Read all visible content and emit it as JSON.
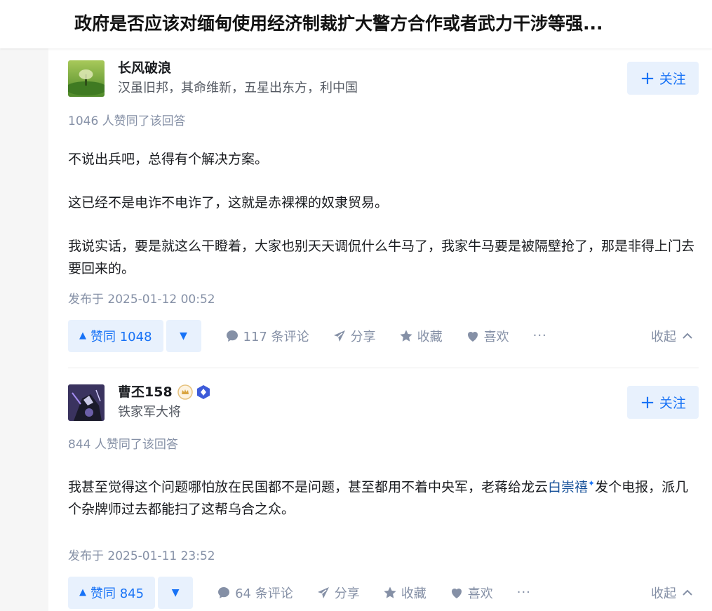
{
  "question": {
    "title": "政府是否应该对缅甸使用经济制裁扩大警方合作或者武力干涉等强..."
  },
  "answers": [
    {
      "author": {
        "name": "长风破浪",
        "headline": "汉虽旧邦，其命维新，五星出东方，利中国"
      },
      "follow_label": "关注",
      "vote_summary": "1046 人赞同了该回答",
      "paragraphs": [
        "不说出兵吧，总得有个解决方案。",
        "这已经不是电诈不电诈了，这就是赤裸裸的奴隶贸易。",
        "我说实话，要是就这么干瞪着，大家也别天天调侃什么牛马了，我家牛马要是被隔壁抢了，那是非得上门去要回来的。"
      ],
      "publish_time": "发布于 2025-01-12 00:52",
      "vote_up_label": "赞同 1048",
      "comments_label": "117 条评论",
      "share_label": "分享",
      "collect_label": "收藏",
      "like_label": "喜欢",
      "more_label": "···",
      "collapse_label": "收起"
    },
    {
      "author": {
        "name": "曹丕158",
        "headline": "铁家军大将"
      },
      "follow_label": "关注",
      "vote_summary": "844 人赞同了该回答",
      "paragraph_before_link": "我甚至觉得这个问题哪怕放在民国都不是问题，甚至都用不着中央军，老蒋给龙云",
      "link_text": "白崇禧",
      "paragraph_after_link": "发个电报，派几个杂牌师过去都能扫了这帮乌合之众。",
      "publish_time": "发布于 2025-01-11 23:52",
      "vote_up_label": "赞同 845",
      "comments_label": "64 条评论",
      "share_label": "分享",
      "collect_label": "收藏",
      "like_label": "喜欢",
      "more_label": "···",
      "collapse_label": "收起"
    }
  ],
  "colors": {
    "accent": "#1772f6",
    "accent_bg": "#e8f1fd",
    "meta": "#8590a6",
    "link": "#175199"
  },
  "icons": [
    "plus-icon",
    "comment-icon",
    "share-icon",
    "star-icon",
    "heart-icon",
    "chevron-up-icon",
    "crown-badge-icon",
    "diamond-badge-icon"
  ]
}
